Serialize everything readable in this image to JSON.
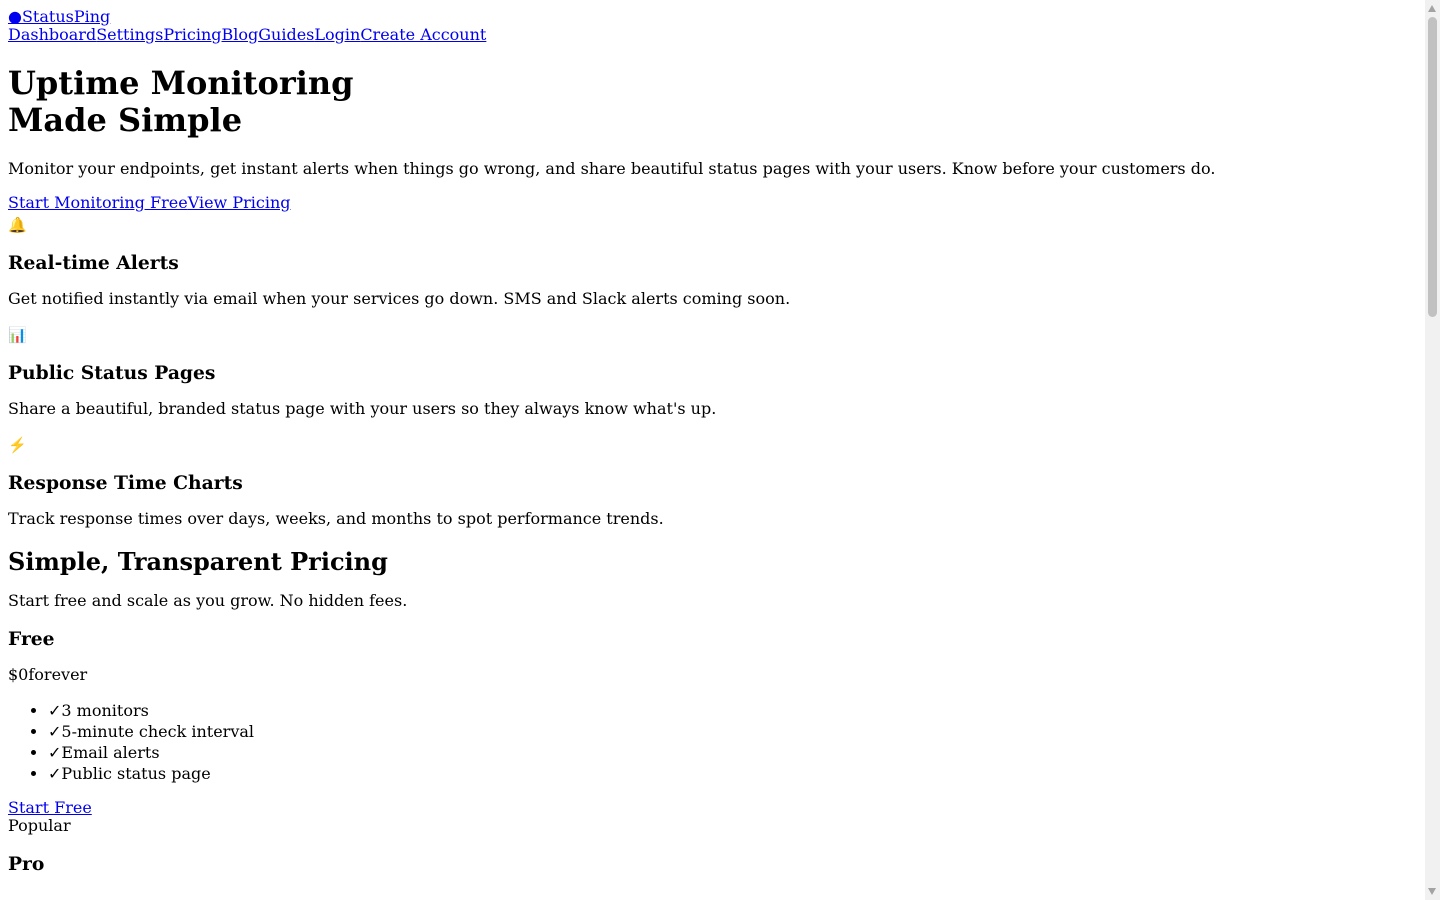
{
  "nav": {
    "logo_dot": "●",
    "logo_text": "StatusPing",
    "links": [
      "Dashboard",
      "Settings",
      "Pricing",
      "Blog",
      "Guides",
      "Login",
      "Create Account"
    ]
  },
  "hero": {
    "title_line1": "Uptime Monitoring",
    "title_line2": "Made Simple",
    "subtitle": "Monitor your endpoints, get instant alerts when things go wrong, and share beautiful status pages with your users. Know before your customers do.",
    "cta_primary": "Start Monitoring Free",
    "cta_secondary": "View Pricing"
  },
  "features": [
    {
      "icon": "🔔",
      "icon_name": "bell-icon",
      "title": "Real-time Alerts",
      "desc": "Get notified instantly via email when your services go down. SMS and Slack alerts coming soon."
    },
    {
      "icon": "📊",
      "icon_name": "bar-chart-icon",
      "title": "Public Status Pages",
      "desc": "Share a beautiful, branded status page with your users so they always know what's up."
    },
    {
      "icon": "⚡",
      "icon_name": "lightning-icon",
      "title": "Response Time Charts",
      "desc": "Track response times over days, weeks, and months to spot performance trends."
    }
  ],
  "pricing": {
    "title": "Simple, Transparent Pricing",
    "subtitle": "Start free and scale as you grow. No hidden fees.",
    "plans": [
      {
        "name": "Free",
        "price": "$0",
        "period": "forever",
        "check": "✓",
        "features": [
          "3 monitors",
          "5-minute check interval",
          "Email alerts",
          "Public status page"
        ],
        "cta": "Start Free"
      },
      {
        "badge": "Popular",
        "name": "Pro"
      }
    ]
  },
  "colors": {
    "link": "#0000ee",
    "text": "#000000"
  }
}
